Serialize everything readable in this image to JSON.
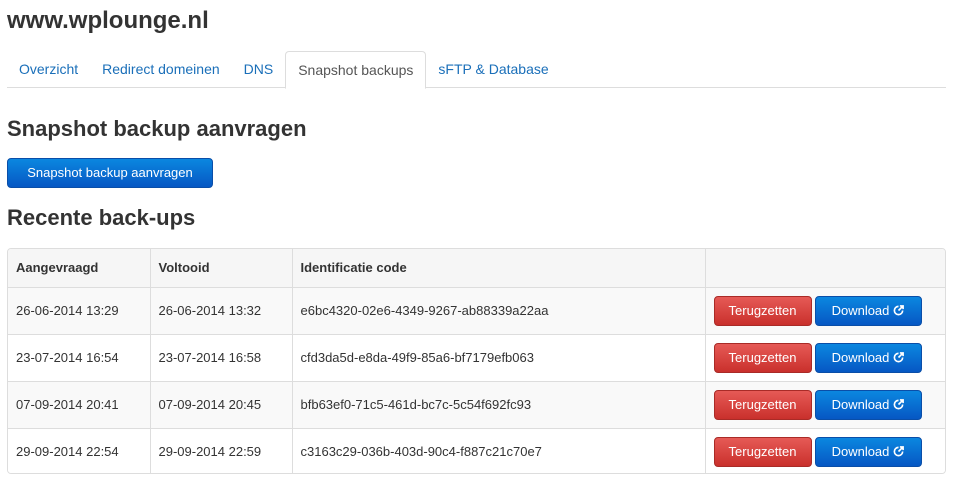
{
  "site": {
    "title": "www.wplounge.nl"
  },
  "tabs": [
    {
      "label": "Overzicht",
      "active": false
    },
    {
      "label": "Redirect domeinen",
      "active": false
    },
    {
      "label": "DNS",
      "active": false
    },
    {
      "label": "Snapshot backups",
      "active": true
    },
    {
      "label": "sFTP & Database",
      "active": false
    }
  ],
  "request_section": {
    "heading": "Snapshot backup aanvragen",
    "button_label": "Snapshot backup aanvragen"
  },
  "recent_section": {
    "heading": "Recente back-ups",
    "columns": [
      "Aangevraagd",
      "Voltooid",
      "Identificatie code",
      ""
    ],
    "rows": [
      {
        "requested": "26-06-2014 13:29",
        "completed": "26-06-2014 13:32",
        "code": "e6bc4320-02e6-4349-9267-ab88339a22aa",
        "restore_label": "Terugzetten",
        "download_label": "Download"
      },
      {
        "requested": "23-07-2014 16:54",
        "completed": "23-07-2014 16:58",
        "code": "cfd3da5d-e8da-49f9-85a6-bf7179efb063",
        "restore_label": "Terugzetten",
        "download_label": "Download"
      },
      {
        "requested": "07-09-2014 20:41",
        "completed": "07-09-2014 20:45",
        "code": "bfb63ef0-71c5-461d-bc7c-5c54f692fc93",
        "restore_label": "Terugzetten",
        "download_label": "Download"
      },
      {
        "requested": "29-09-2014 22:54",
        "completed": "29-09-2014 22:59",
        "code": "c3163c29-036b-403d-90c4-f887c21c70e7",
        "restore_label": "Terugzetten",
        "download_label": "Download"
      }
    ]
  },
  "colors": {
    "primary": "#0a6fd6",
    "danger": "#d9403c",
    "link": "#1a6fb9"
  },
  "icons": {
    "download": "external-link-icon"
  }
}
